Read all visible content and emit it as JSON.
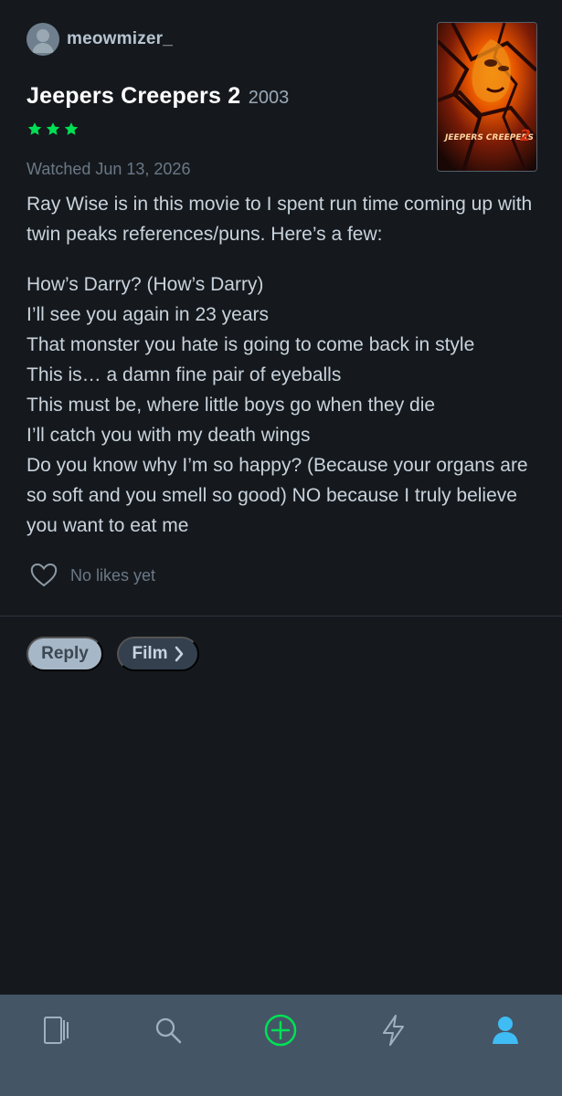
{
  "review": {
    "username": "meowmizer_",
    "film_title": "Jeepers Creepers 2",
    "film_year": "2003",
    "rating_stars": 3,
    "watched_text": "Watched Jun 13, 2026",
    "intro": "Ray Wise is in this movie to I spent run time coming up with twin peaks references/puns. Here’s a few:",
    "lines": [
      "How’s Darry? (How’s Darry)",
      "I’ll see you again in 23 years",
      "That monster you hate is going to come back in style",
      "This is… a damn fine pair of eyeballs",
      "This must be, where little boys go when they die",
      "I’ll catch you with my death wings",
      "Do you know why I’m so happy? (Because your organs are so soft and you smell so good) NO because I truly believe you want to eat me"
    ],
    "likes_text": "No likes yet",
    "poster_text": "JEEPERS CREEPERS 2"
  },
  "actions": {
    "reply_label": "Reply",
    "film_label": "Film"
  },
  "tabbar": {
    "tabs": [
      {
        "icon": "films-icon"
      },
      {
        "icon": "search-icon"
      },
      {
        "icon": "add-icon"
      },
      {
        "icon": "activity-icon"
      },
      {
        "icon": "profile-icon"
      }
    ]
  },
  "colors": {
    "background": "#15191d",
    "star_green": "#00e054",
    "tabbar": "#445566",
    "active_tab": "#40bcf4"
  }
}
